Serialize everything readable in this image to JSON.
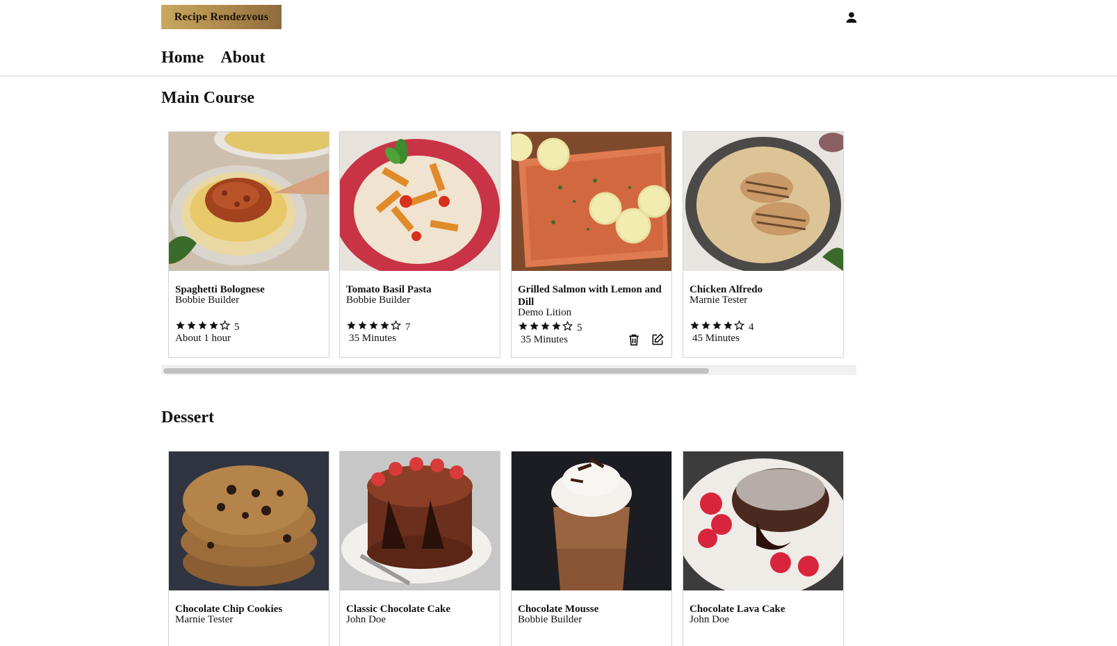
{
  "app": {
    "logo_text": "Recipe Rendezvous"
  },
  "nav": {
    "home": "Home",
    "about": "About"
  },
  "sections": [
    {
      "title": "Main Course",
      "cards": [
        {
          "title": "Spaghetti Bolognese",
          "author": "Bobbie Builder",
          "stars": 4,
          "rating_count": "5",
          "time": "About 1 hour",
          "owned": false,
          "image": "spaghetti-bolognese"
        },
        {
          "title": "Tomato Basil Pasta",
          "author": "Bobbie Builder",
          "stars": 4,
          "rating_count": "7",
          "time": "35 Minutes",
          "owned": false,
          "image": "tomato-basil-pasta"
        },
        {
          "title": "Grilled Salmon with Lemon and Dill",
          "author": "Demo Lition",
          "stars": 4,
          "rating_count": "5",
          "time": "35 Minutes",
          "owned": true,
          "image": "grilled-salmon"
        },
        {
          "title": "Chicken Alfredo",
          "author": "Marnie Tester",
          "stars": 4,
          "rating_count": "4",
          "time": "45 Minutes",
          "owned": false,
          "image": "chicken-alfredo"
        }
      ],
      "scroll_fraction": 0.79
    },
    {
      "title": "Dessert",
      "cards": [
        {
          "title": "Chocolate Chip Cookies",
          "author": "Marnie Tester",
          "image": "chocolate-chip-cookies"
        },
        {
          "title": "Classic Chocolate Cake",
          "author": "John Doe",
          "image": "chocolate-cake"
        },
        {
          "title": "Chocolate Mousse",
          "author": "Bobbie Builder",
          "image": "chocolate-mousse"
        },
        {
          "title": "Chocolate Lava Cake",
          "author": "John Doe",
          "image": "chocolate-lava-cake"
        }
      ]
    }
  ],
  "icons": {
    "user": "user-icon",
    "star_filled": "star-filled-icon",
    "star_outline": "star-outline-icon",
    "delete": "trash-icon",
    "edit": "edit-icon"
  },
  "colors": {
    "logo_gradient_start": "#c8a85e",
    "logo_gradient_end": "#8e6a3e",
    "border": "#d2d2d2",
    "scroll_thumb": "#c1c1c1"
  }
}
